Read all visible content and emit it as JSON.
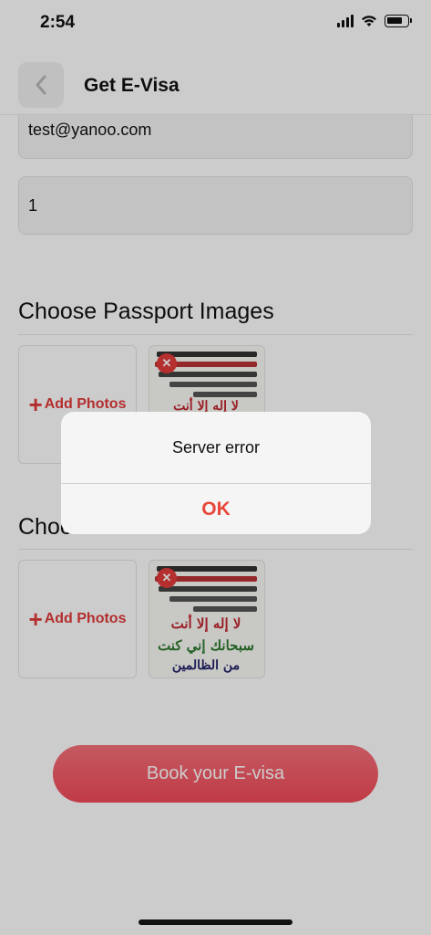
{
  "status": {
    "time": "2:54"
  },
  "header": {
    "title": "Get E-Visa",
    "back_icon": "chevron-left-icon"
  },
  "form": {
    "email_value": "test@yanoo.com",
    "number_value": "1"
  },
  "sections": [
    {
      "title": "Choose Passport Images",
      "add_label": "Add Photos"
    },
    {
      "title": "Choo",
      "add_label": "Add Photos"
    }
  ],
  "thumbnail_text": {
    "line1": "لا إله إلا أنت",
    "line2": "سبحانك إني كنت",
    "line3": "من الظالمين"
  },
  "book_button": "Book your E-visa",
  "alert": {
    "message": "Server error",
    "ok": "OK"
  },
  "colors": {
    "accent": "#e8473a",
    "button": "#f24a58"
  }
}
